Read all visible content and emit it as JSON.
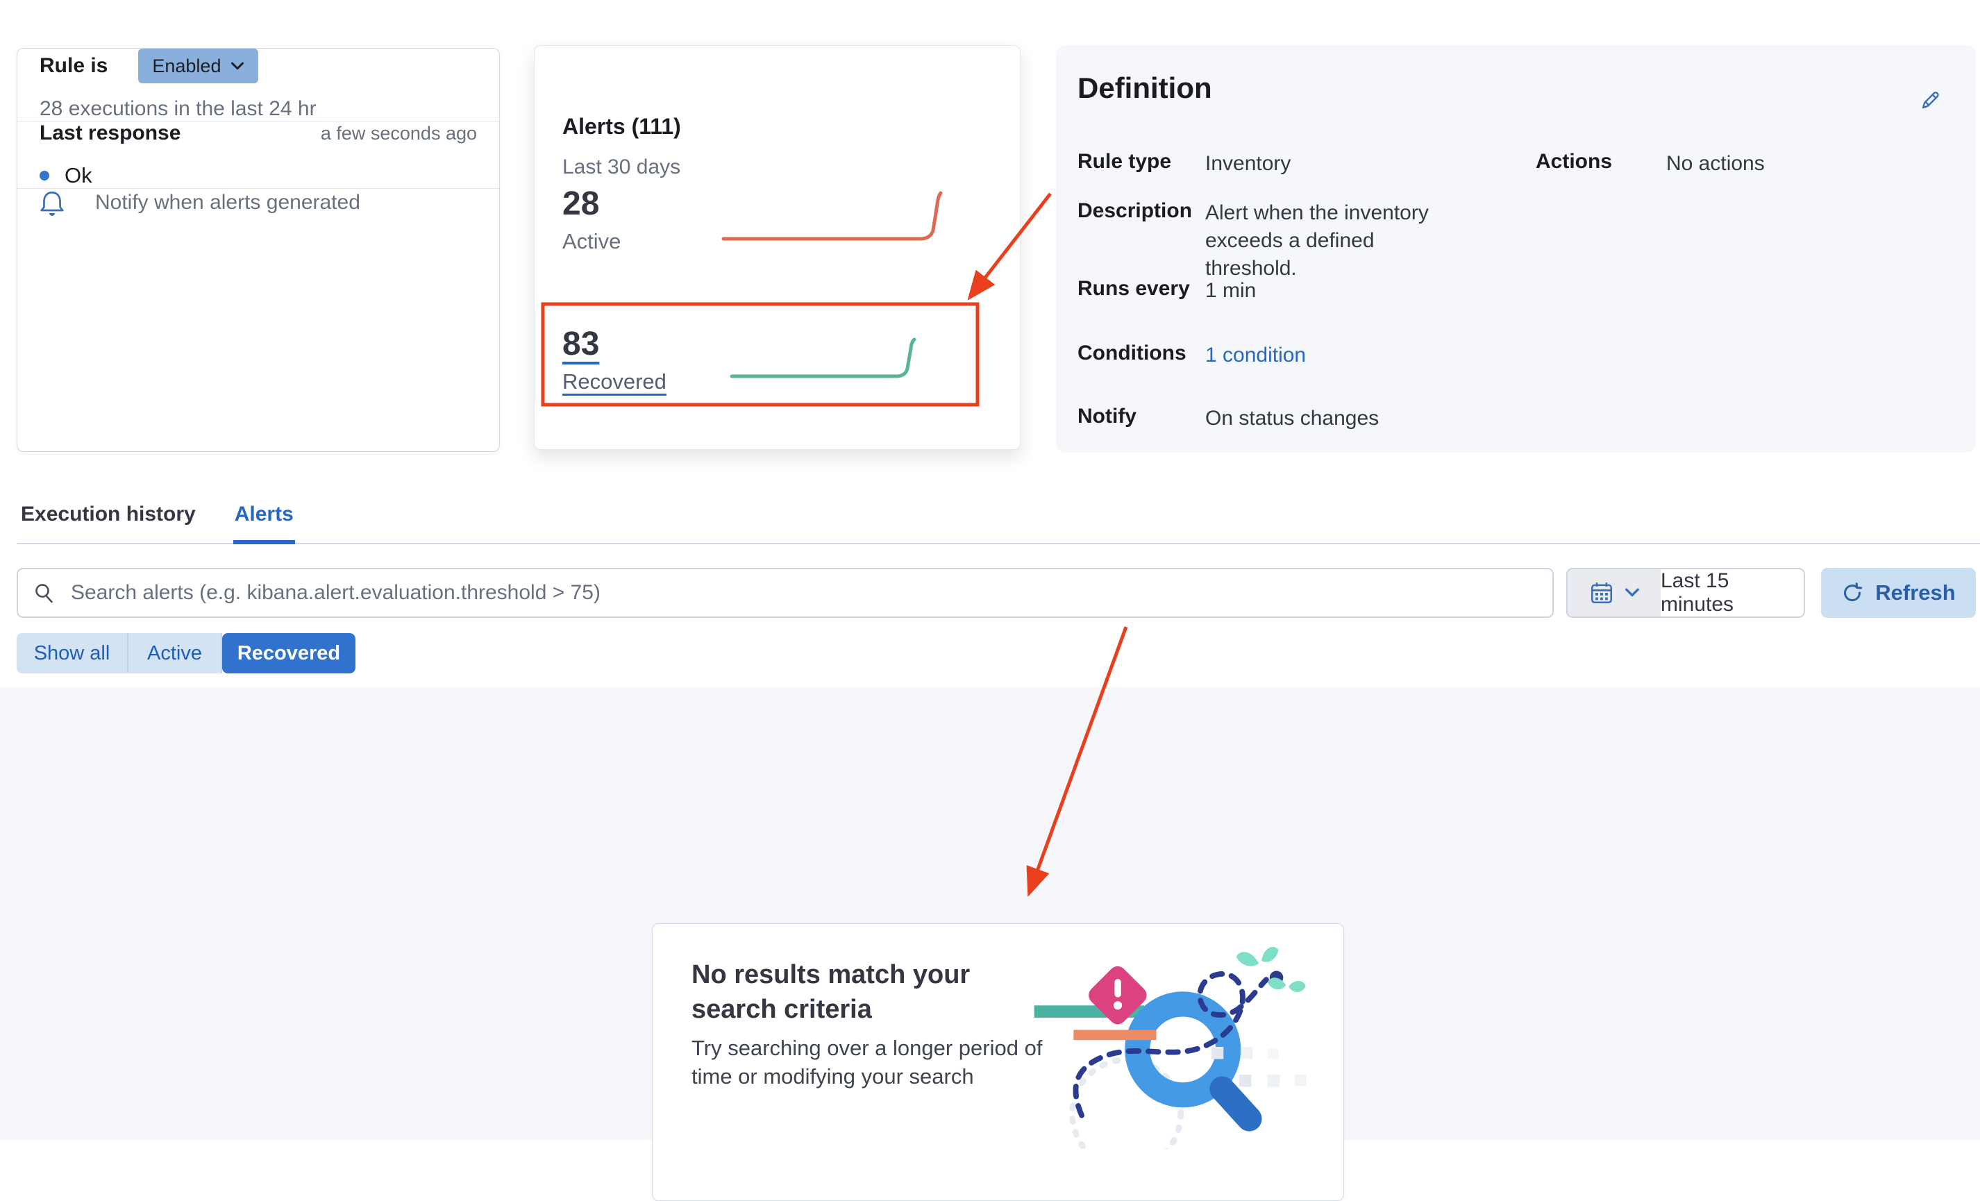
{
  "rule_card": {
    "rule_is_label": "Rule is",
    "status_badge": "Enabled",
    "executions_text": "28 executions in the last 24 hr",
    "last_response_label": "Last response",
    "last_response_time": "a few seconds ago",
    "last_response_value": "Ok",
    "notify_text": "Notify when alerts generated"
  },
  "alerts_card": {
    "title": "Alerts (111)",
    "subtitle": "Last 30 days",
    "active": {
      "count": "28",
      "label": "Active"
    },
    "recovered": {
      "count": "83",
      "label": "Recovered"
    },
    "sparklines": {
      "active_color": "#DC6A52",
      "recovered_color": "#57B499",
      "trend": "flat then spike up at the end of the 30 day window"
    }
  },
  "definition": {
    "title": "Definition",
    "rows": [
      {
        "label": "Rule type",
        "value": "Inventory"
      },
      {
        "label": "Description",
        "value": "Alert when the inventory exceeds a defined threshold."
      },
      {
        "label": "Runs every",
        "value": "1 min"
      },
      {
        "label": "Conditions",
        "value": "1 condition"
      },
      {
        "label": "Notify",
        "value": "On status changes"
      },
      {
        "label": "Actions",
        "value": "No actions"
      }
    ]
  },
  "tabs": {
    "items": [
      {
        "label": "Execution history"
      },
      {
        "label": "Alerts"
      }
    ],
    "selected": "Alerts"
  },
  "search": {
    "placeholder": "Search alerts (e.g. kibana.alert.evaluation.threshold > 75)"
  },
  "time_picker": {
    "value": "Last 15 minutes"
  },
  "refresh": {
    "label": "Refresh"
  },
  "filters": {
    "buttons": [
      {
        "label": "Show all"
      },
      {
        "label": "Active"
      },
      {
        "label": "Recovered"
      }
    ],
    "selected": "Recovered"
  },
  "empty_state": {
    "title": "No results match your search criteria",
    "body": "Try searching over a longer period of time or modifying your search"
  },
  "colors": {
    "accent_blue": "#2567C5",
    "badge_blue": "#89AFDC",
    "filter_selected_blue": "#3173CC",
    "icon_blue": "#3B6FB5",
    "sparkline_red": "#DC6A52",
    "sparkline_green": "#57B499",
    "annotation_red": "#E8401E",
    "panel_gray": "#F5F7FB",
    "text_gray": "#69707D"
  }
}
